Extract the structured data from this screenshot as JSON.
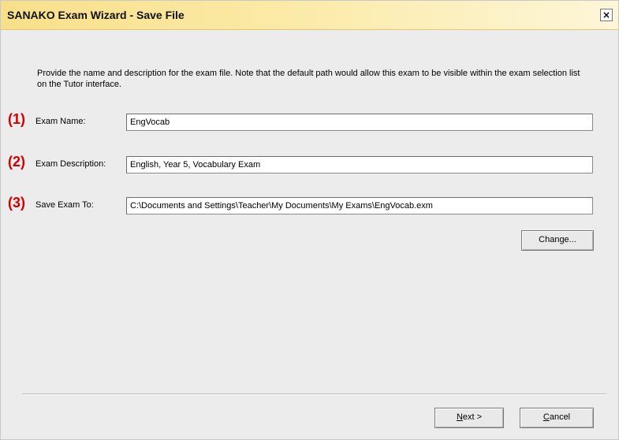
{
  "window": {
    "title": "SANAKO Exam Wizard - Save File",
    "close_glyph": "×",
    "titlebar_color": "#f8e08a"
  },
  "instructions": "Provide the name and description for the exam file. Note that the default path would allow this exam to be visible within the exam selection list on the Tutor interface.",
  "fields": [
    {
      "marker": "(1)",
      "label": "Exam Name:",
      "value": "EngVocab"
    },
    {
      "marker": "(2)",
      "label": "Exam Description:",
      "value": "English, Year 5, Vocabulary Exam"
    },
    {
      "marker": "(3)",
      "label": "Save Exam To:",
      "value": "C:\\Documents and Settings\\Teacher\\My Documents\\My Exams\\EngVocab.exm"
    }
  ],
  "buttons": {
    "change": "Change...",
    "next_mnemonic": "N",
    "next_rest": "ext >",
    "cancel_mnemonic": "C",
    "cancel_rest": "ancel"
  },
  "marker_color": "#d10000"
}
